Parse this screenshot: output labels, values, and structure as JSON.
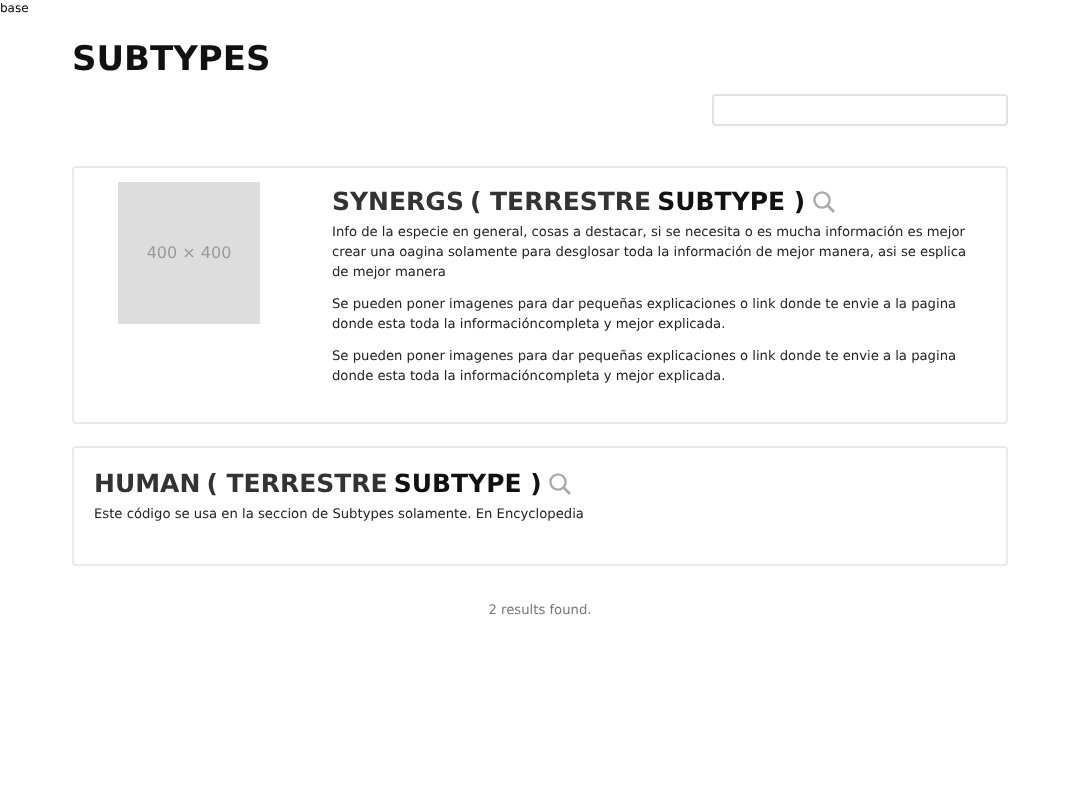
{
  "breadcrumb": "base",
  "page_title": "SUBTYPES",
  "results": [
    {
      "image": {
        "kind": "placeholder",
        "label": "400 × 400"
      },
      "name": "SYNERGS",
      "category": "( TERRESTRE",
      "subtype": "SUBTYPE )",
      "paragraphs": [
        "Info de la especie en general, cosas a destacar, si se necesita o es mucha información es mejor crear una oagina solamente para desglosar toda la información de mejor manera, asi se esplica de mejor manera",
        "Se pueden poner imagenes para dar pequeñas explicaciones o link donde te envie a la pagina donde esta toda la informacióncompleta y mejor explicada.",
        "Se pueden poner imagenes para dar pequeñas explicaciones o link donde te envie a la pagina donde esta toda la informacióncompleta y mejor explicada."
      ]
    },
    {
      "name": "HUMAN",
      "category": "( TERRESTRE",
      "subtype": "SUBTYPE )",
      "paragraphs": [
        "Este código se usa en la seccion de Subtypes solamente. En Encyclopedia"
      ]
    }
  ],
  "results_count": "2 results found."
}
